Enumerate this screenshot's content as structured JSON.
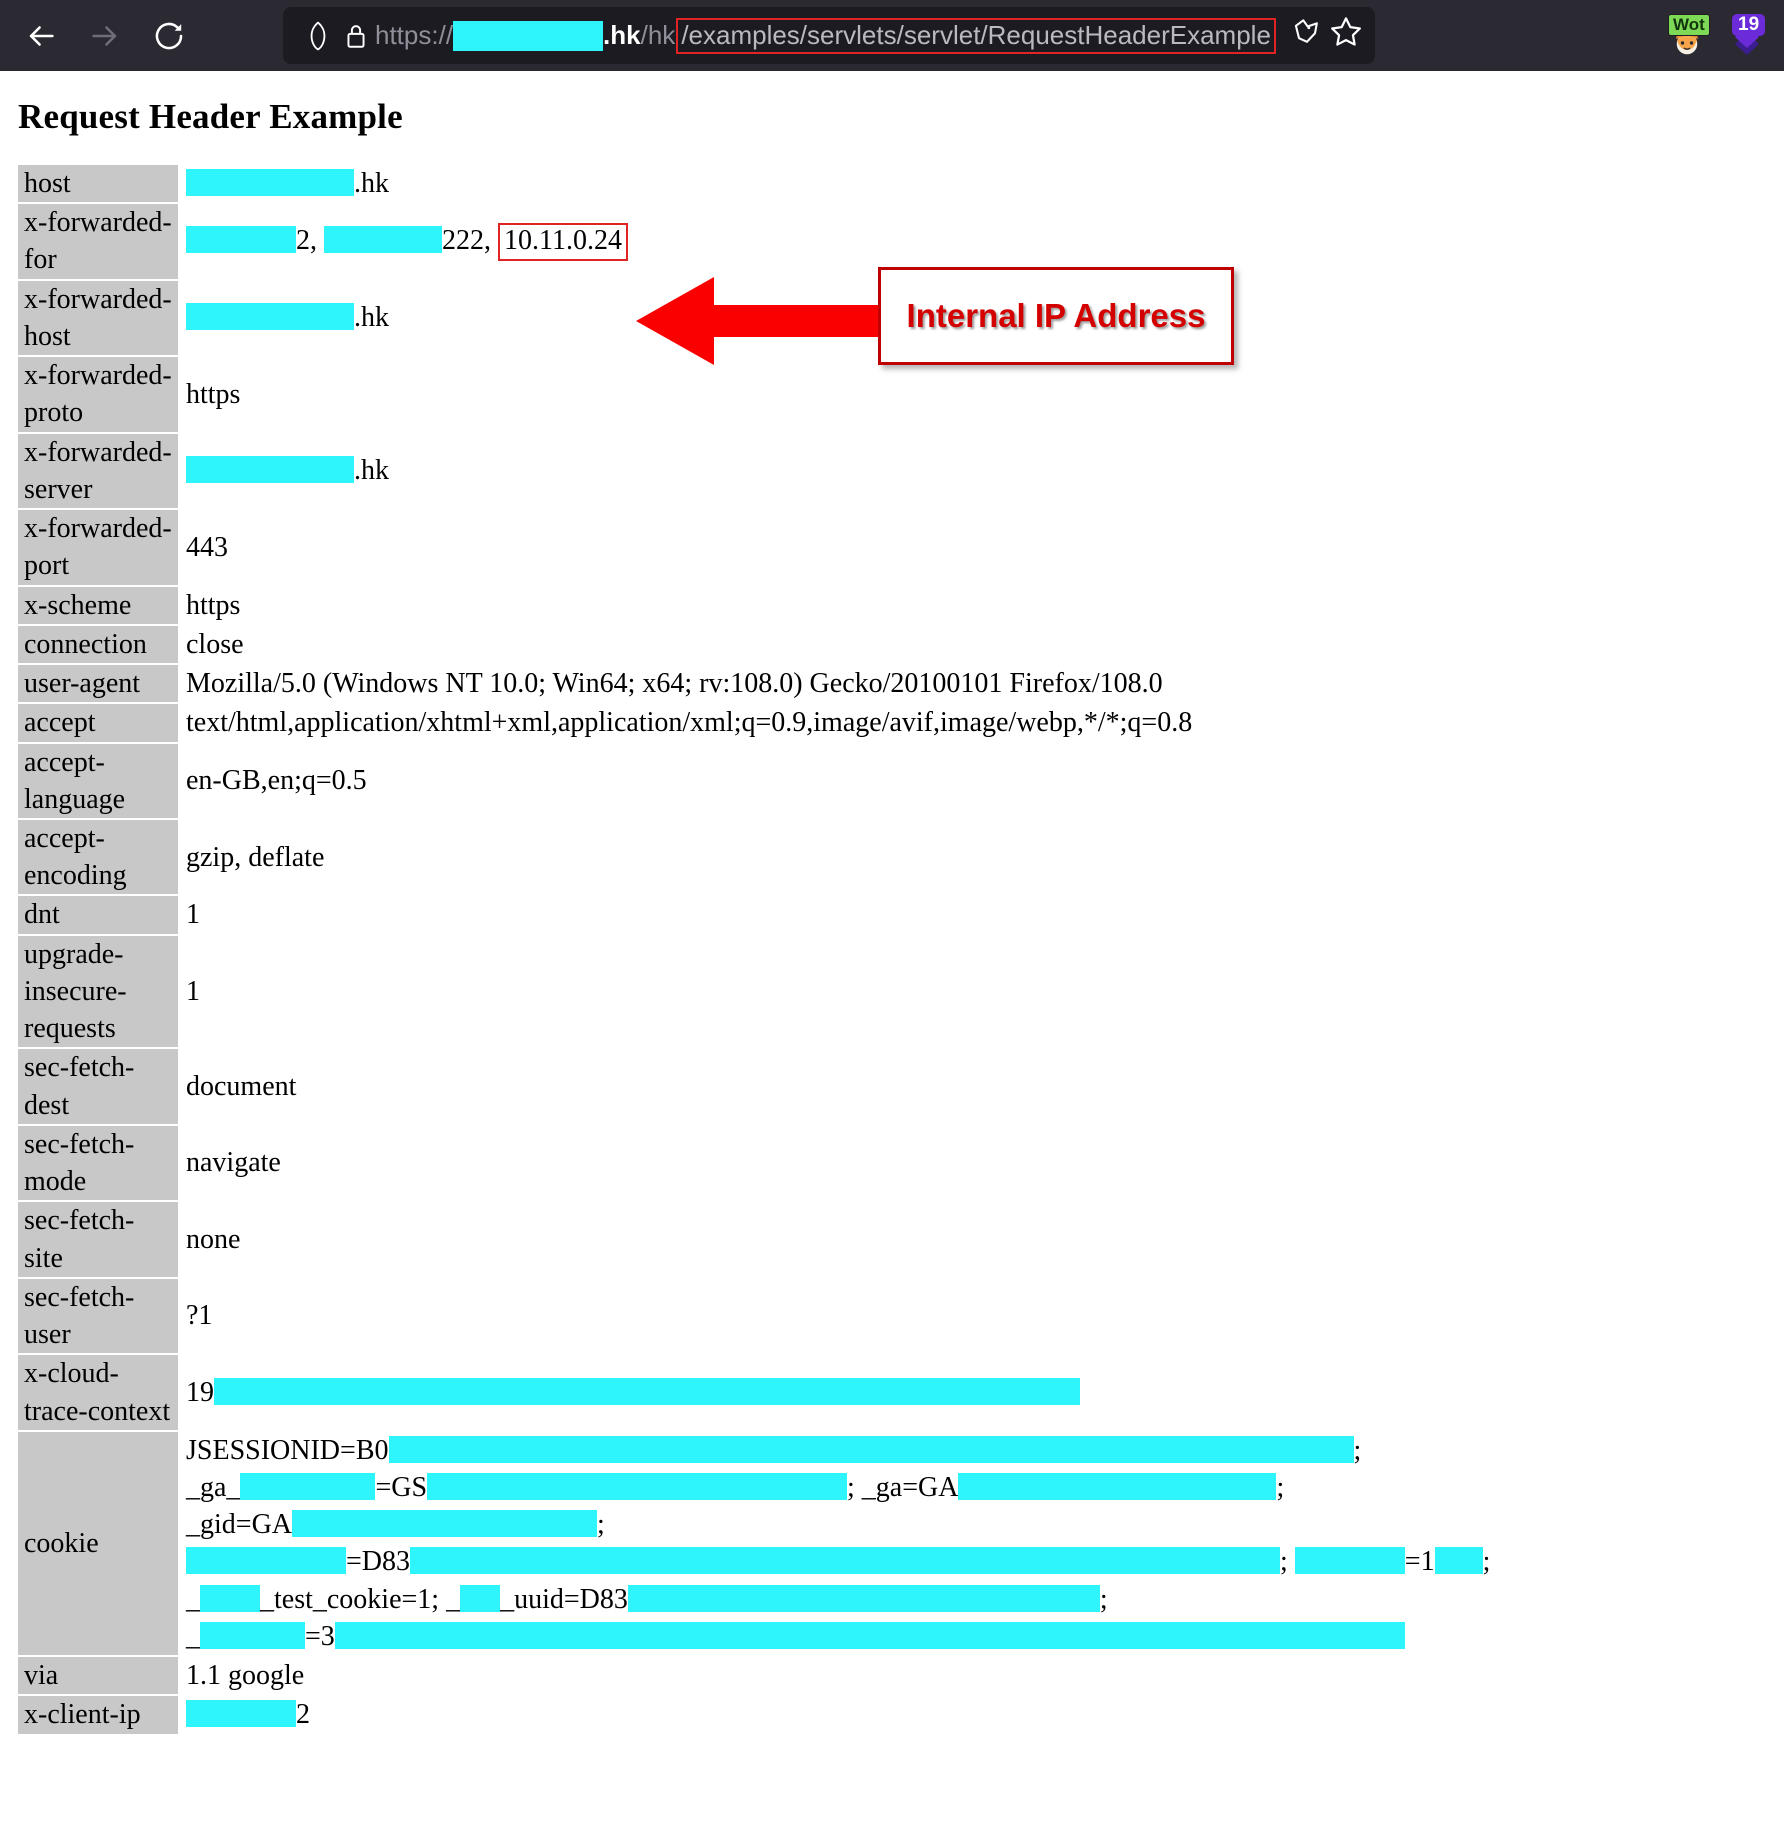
{
  "browser": {
    "nav": {
      "back_icon": "arrow-left-icon",
      "forward_icon": "arrow-right-icon",
      "reload_icon": "reload-icon"
    },
    "urlbar": {
      "shield_icon": "shield-icon",
      "lock_icon": "padlock-icon",
      "scheme": "https://",
      "redacted_host_width": 150,
      "tld": ".hk",
      "path_prefix": "/hk",
      "path_highlighted": "/examples/servlets/servlet/RequestHeaderExample",
      "pocket_icon": "pocket-icon",
      "bookmark_icon": "star-icon"
    },
    "extensions": [
      {
        "name": "wot-extension-icon",
        "label": "Wot",
        "badge_color": "#7ed957"
      },
      {
        "name": "badge-extension-icon",
        "label": "19",
        "badge_color": "#6c2bd9"
      }
    ]
  },
  "page": {
    "title": "Request Header Example",
    "headers": [
      {
        "name": "host",
        "value_html": "<span class=\"rd\" style=\"width:168px\"></span>.hk"
      },
      {
        "name": "x-forwarded-for",
        "value_html": "<span class=\"rd\" style=\"width:110px\"></span>2, <span class=\"rd\" style=\"width:118px\"></span>222, <span class=\"ipbox\">10.11.0.24</span>"
      },
      {
        "name": "x-forwarded-host",
        "value_html": "<span class=\"rd\" style=\"width:168px\"></span>.hk"
      },
      {
        "name": "x-forwarded-proto",
        "value_html": "https"
      },
      {
        "name": "x-forwarded-server",
        "value_html": "<span class=\"rd\" style=\"width:168px\"></span>.hk"
      },
      {
        "name": "x-forwarded-port",
        "value_html": "443"
      },
      {
        "name": "x-scheme",
        "value_html": "https"
      },
      {
        "name": "connection",
        "value_html": "close"
      },
      {
        "name": "user-agent",
        "value_html": "Mozilla/5.0 (Windows NT 10.0; Win64; x64; rv:108.0) Gecko/20100101 Firefox/108.0"
      },
      {
        "name": "accept",
        "value_html": "text/html,application/xhtml+xml,application/xml;q=0.9,image/avif,image/webp,*/*;q=0.8"
      },
      {
        "name": "accept-language",
        "value_html": "en-GB,en;q=0.5"
      },
      {
        "name": "accept-encoding",
        "value_html": "gzip, deflate"
      },
      {
        "name": "dnt",
        "value_html": "1"
      },
      {
        "name": "upgrade-insecure-requests",
        "value_html": "1"
      },
      {
        "name": "sec-fetch-dest",
        "value_html": "document"
      },
      {
        "name": "sec-fetch-mode",
        "value_html": "navigate"
      },
      {
        "name": "sec-fetch-site",
        "value_html": "none"
      },
      {
        "name": "sec-fetch-user",
        "value_html": "?1"
      },
      {
        "name": "x-cloud-trace-context",
        "value_html": "19<span class=\"rd\" style=\"width:866px\"></span>"
      },
      {
        "name": "cookie",
        "value_html": "<span class=\"ck-line\">JSESSIONID=B0<span class=\"rd\" style=\"width:965px\"></span>;</span><span class=\"ck-line\">_ga_<span class=\"rd\" style=\"width:135px\"></span>=GS<span class=\"rd\" style=\"width:420px\"></span>; _ga=GA<span class=\"rd\" style=\"width:318px\"></span>;</span><span class=\"ck-line\">_gid=GA<span class=\"rd\" style=\"width:305px\"></span>;</span><span class=\"ck-line\"><span class=\"rd\" style=\"width:160px\"></span>=D83<span class=\"rd\" style=\"width:870px\"></span>; <span class=\"rd\" style=\"width:110px\"></span>=1<span class=\"rd\" style=\"width:48px\"></span>;</span><span class=\"ck-line\">_<span class=\"rd\" style=\"width:60px\"></span>_test_cookie=1; _<span class=\"rd\" style=\"width:40px\"></span>_uuid=D83<span class=\"rd\" style=\"width:472px\"></span>;</span><span class=\"ck-line\">_<span class=\"rd\" style=\"width:105px\"></span>=3<span class=\"rd\" style=\"width:1070px\"></span></span>"
      },
      {
        "name": "via",
        "value_html": "1.1 google"
      },
      {
        "name": "x-client-ip",
        "value_html": "<span class=\"rd\" style=\"width:110px\"></span>2"
      }
    ]
  },
  "annotation": {
    "callout_text": "Internal IP Address",
    "arrow_icon": "left-arrow-annotation",
    "highlight_color": "#d40000",
    "redaction_color": "#2ef4fc",
    "header_cell_color": "#c8c8c8"
  }
}
